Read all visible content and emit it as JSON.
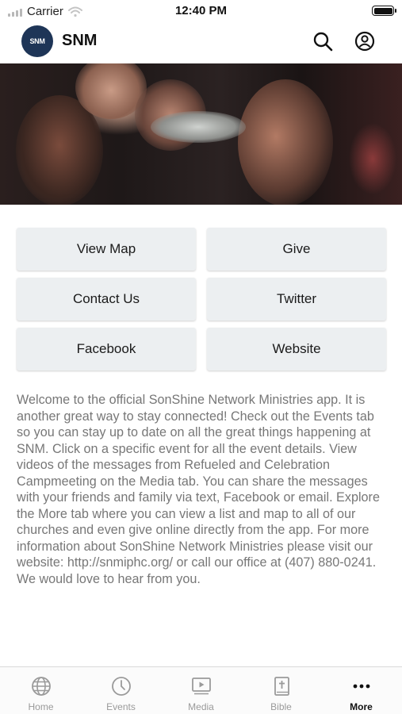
{
  "status_bar": {
    "carrier": "Carrier",
    "time": "12:40 PM"
  },
  "header": {
    "logo_text": "SNM",
    "title": "SNM"
  },
  "buttons": [
    {
      "label": "View Map"
    },
    {
      "label": "Give"
    },
    {
      "label": "Contact Us"
    },
    {
      "label": "Twitter"
    },
    {
      "label": "Facebook"
    },
    {
      "label": "Website"
    }
  ],
  "welcome_text": "Welcome to the official SonShine Network Ministries app. It is another great way to stay connected!   Check out the Events tab so you can stay up to date on all the great things happening at SNM. Click on a specific event for all the event details. View videos of the messages from Refueled and Celebration Campmeeting on the Media tab. You can share the messages with your friends and family via text, Facebook or email.   Explore the More tab where you can view a list and map to all of our churches and even give online directly from the app.  For more information about SonShine Network Ministries please visit our website: http://snmiphc.org/ or call our office at (407) 880-0241. We would love to hear from you.",
  "tabs": [
    {
      "label": "Home",
      "icon": "globe-icon"
    },
    {
      "label": "Events",
      "icon": "clock-icon"
    },
    {
      "label": "Media",
      "icon": "video-icon"
    },
    {
      "label": "Bible",
      "icon": "bible-icon"
    },
    {
      "label": "More",
      "icon": "more-dots-icon",
      "active": true
    }
  ],
  "colors": {
    "logo_bg": "#1e3557",
    "button_bg": "#eceff1",
    "body_text": "#777777",
    "tab_inactive": "#9a9a9a"
  }
}
